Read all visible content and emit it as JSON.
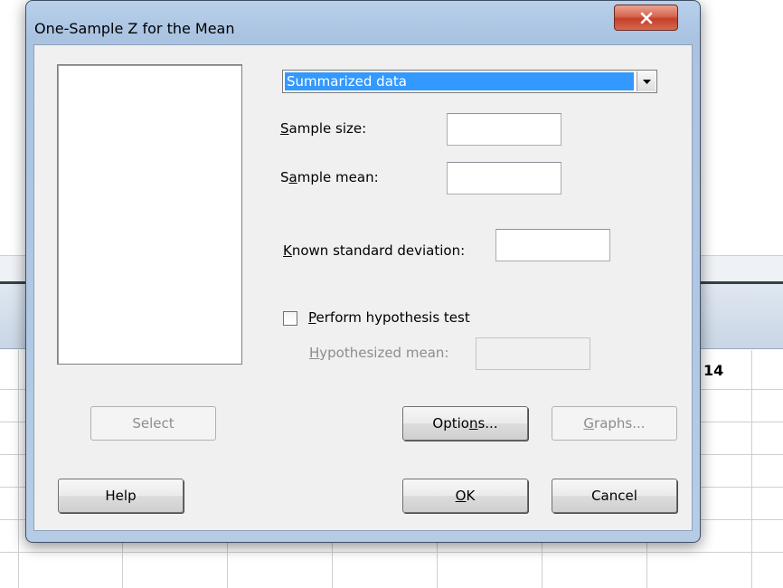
{
  "worksheet": {
    "column_label": "14"
  },
  "dialog": {
    "title": "One-Sample Z for the Mean",
    "data_mode": {
      "selected": "Summarized data"
    },
    "fields": {
      "sample_size": {
        "prefix": "",
        "mnemonic": "S",
        "suffix": "ample size:",
        "value": ""
      },
      "sample_mean": {
        "prefix": "S",
        "mnemonic": "a",
        "suffix": "mple mean:",
        "value": ""
      },
      "known_sd": {
        "prefix": "",
        "mnemonic": "K",
        "suffix": "nown standard deviation:",
        "value": ""
      },
      "hypothesized_mean": {
        "prefix": "",
        "mnemonic": "H",
        "suffix": "ypothesized mean:",
        "value": ""
      }
    },
    "hypothesis_test": {
      "checked": false,
      "prefix": "",
      "mnemonic": "P",
      "suffix": "erform hypothesis test"
    },
    "buttons": {
      "select": "Select",
      "options": {
        "prefix": "Optio",
        "mnemonic": "n",
        "suffix": "s..."
      },
      "graphs": {
        "prefix": "",
        "mnemonic": "G",
        "suffix": "raphs..."
      },
      "help": "Help",
      "ok": {
        "prefix": "",
        "mnemonic": "O",
        "suffix": "K"
      },
      "cancel": "Cancel"
    }
  }
}
